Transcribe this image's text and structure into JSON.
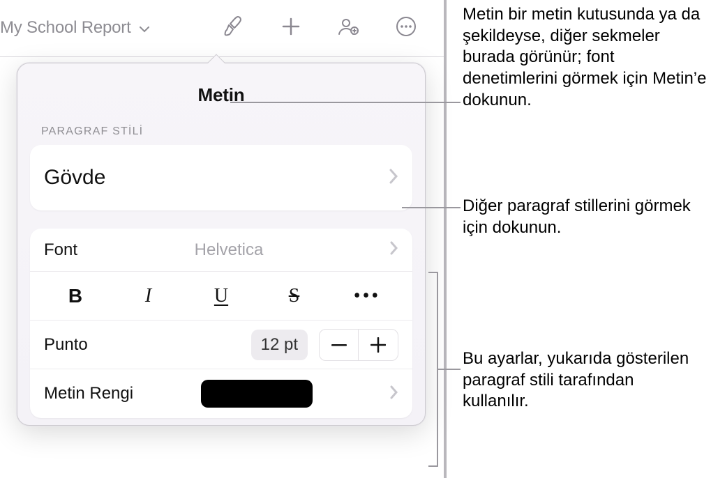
{
  "toolbar": {
    "doc_title": "My School Report"
  },
  "popover": {
    "tab_title": "Metin",
    "paragraph_style_label": "PARAGRAF STİLİ",
    "paragraph_style_value": "Gövde",
    "font_label": "Font",
    "font_value": "Helvetica",
    "style_buttons": {
      "bold": "B",
      "italic": "I",
      "underline": "U",
      "strike": "S",
      "more": "•••"
    },
    "size_label": "Punto",
    "size_value": "12 pt",
    "text_color_label": "Metin Rengi",
    "text_color_value": "#000000"
  },
  "callouts": {
    "c1": "Metin bir metin kutusunda ya da şekildeyse, diğer sekmeler burada görünür; font denetimlerini görmek için Metin’e dokunun.",
    "c2": "Diğer paragraf stillerini görmek için dokunun.",
    "c3": "Bu ayarlar, yukarıda gösterilen paragraf stili tarafından kullanılır."
  }
}
